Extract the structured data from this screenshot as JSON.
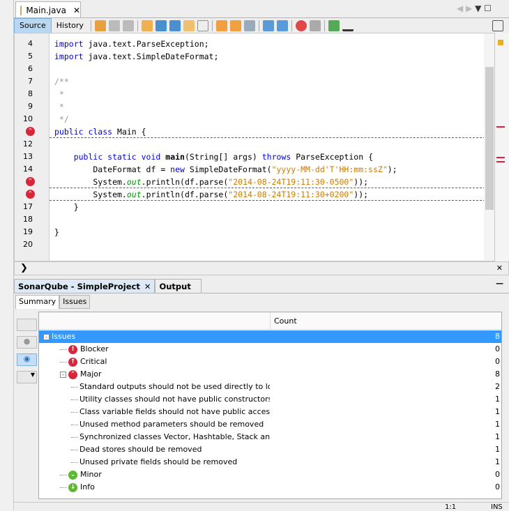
{
  "editor": {
    "tab_title": "Main.java",
    "source_label": "Source",
    "history_label": "History",
    "lines": [
      {
        "n": "4",
        "html": "<span class='kw'>import</span> java.text.ParseException;"
      },
      {
        "n": "5",
        "html": "<span class='kw'>import</span> java.text.SimpleDateFormat;"
      },
      {
        "n": "6",
        "html": ""
      },
      {
        "n": "7",
        "html": "<span class='cm'>/**</span>"
      },
      {
        "n": "8",
        "html": "<span class='cm'> *</span>"
      },
      {
        "n": "9",
        "html": "<span class='cm'> *</span>"
      },
      {
        "n": "10",
        "html": "<span class='cm'> */</span>"
      },
      {
        "n": "11",
        "err": true,
        "html": "<span class='kw'>public class</span> Main {"
      },
      {
        "n": "12",
        "html": ""
      },
      {
        "n": "13",
        "html": "    <span class='kw'>public static void</span> <span class='b'>main</span>(String[] args) <span class='kw'>throws</span> ParseException {"
      },
      {
        "n": "14",
        "html": "        DateFormat df = <span class='kw'>new</span> SimpleDateFormat(<span class='str'>\"yyyy-MM-dd'T'HH:mm:ssZ\"</span>);"
      },
      {
        "n": "15",
        "err": true,
        "html": "        System.<span class='it'>out</span>.println(df.parse(<span class='str'>\"2014-08-24T19:11:30-0500\"</span>));"
      },
      {
        "n": "16",
        "err": true,
        "html": "        System.<span class='it'>out</span>.println(df.parse(<span class='str'>\"2014-08-24T19:11:30+0200\"</span>));"
      },
      {
        "n": "17",
        "html": "    }"
      },
      {
        "n": "18",
        "html": ""
      },
      {
        "n": "19",
        "html": "}"
      },
      {
        "n": "20",
        "html": ""
      }
    ]
  },
  "panel": {
    "tab_sonar": "SonarQube - SimpleProject",
    "tab_output": "Output",
    "subtab_summary": "Summary",
    "subtab_issues": "Issues",
    "col_count": "Count",
    "rows": [
      {
        "label": "Issues",
        "count": "8",
        "level": 0,
        "sel": true
      },
      {
        "label": "Blocker",
        "count": "0",
        "level": 1,
        "sev": "blocker"
      },
      {
        "label": "Critical",
        "count": "0",
        "level": 1,
        "sev": "critical"
      },
      {
        "label": "Major",
        "count": "8",
        "level": 1,
        "sev": "major"
      },
      {
        "label": "Standard outputs should not be used directly to log anyth",
        "count": "2",
        "level": 2
      },
      {
        "label": "Utility classes should not have public constructors",
        "count": "1",
        "level": 2
      },
      {
        "label": "Class variable fields should not have public accessibility",
        "count": "1",
        "level": 2
      },
      {
        "label": "Unused method parameters should be removed",
        "count": "1",
        "level": 2
      },
      {
        "label": "Synchronized classes Vector, Hashtable, Stack and String",
        "count": "1",
        "level": 2
      },
      {
        "label": "Dead stores should be removed",
        "count": "1",
        "level": 2
      },
      {
        "label": "Unused private fields should be removed",
        "count": "1",
        "level": 2
      },
      {
        "label": "Minor",
        "count": "0",
        "level": 1,
        "sev": "minor"
      },
      {
        "label": "Info",
        "count": "0",
        "level": 1,
        "sev": "info"
      }
    ]
  },
  "status": {
    "position": "1:1",
    "mode": "INS"
  },
  "colors": {
    "error": "#d7263a",
    "selection": "#3399ff",
    "minor": "#5cb82e"
  }
}
